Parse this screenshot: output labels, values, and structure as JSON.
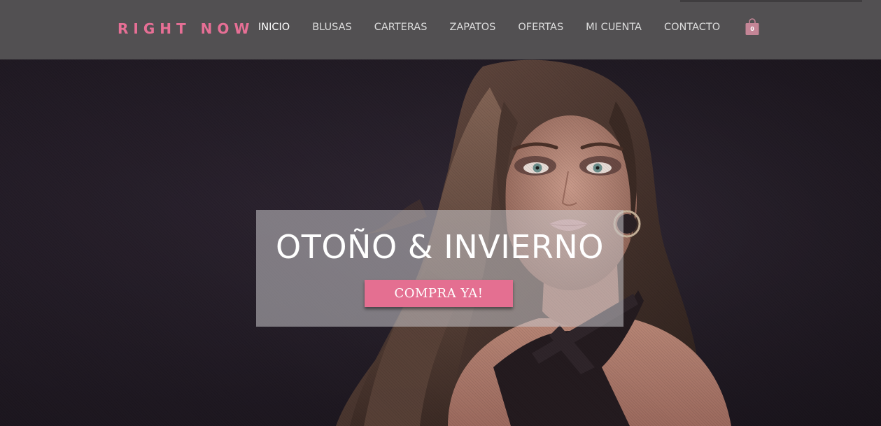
{
  "brand": {
    "name": "RIGHT NOW",
    "accent_color": "#e66f95"
  },
  "nav": {
    "items": [
      {
        "label": "INICIO",
        "active": true
      },
      {
        "label": "BLUSAS",
        "active": false
      },
      {
        "label": "CARTERAS",
        "active": false
      },
      {
        "label": "ZAPATOS",
        "active": false
      },
      {
        "label": "OFERTAS",
        "active": false
      },
      {
        "label": "MI CUENTA",
        "active": false
      },
      {
        "label": "CONTACTO",
        "active": false
      }
    ]
  },
  "cart": {
    "icon": "shopping-bag-icon",
    "count": "0"
  },
  "hero": {
    "title": "OTOÑO & INVIERNO",
    "button_label": "COMPRA YA!",
    "button_color": "#e46f91"
  }
}
